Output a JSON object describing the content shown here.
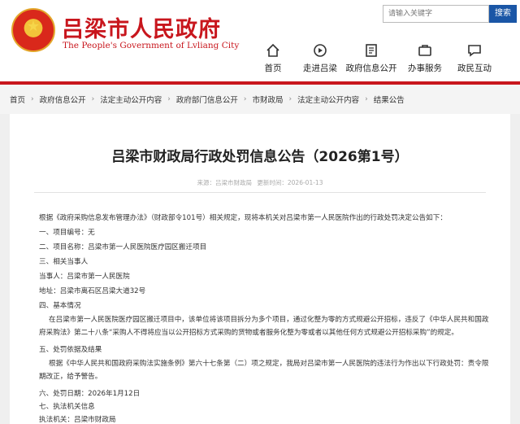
{
  "header": {
    "logo_cn": "吕梁市人民政府",
    "logo_en": "The People's Government of Lvliang City",
    "search_placeholder": "请输入关键字",
    "search_button": "搜索",
    "nav": [
      {
        "label": "首页",
        "icon": "home-icon"
      },
      {
        "label": "走进吕梁",
        "icon": "compass-icon"
      },
      {
        "label": "政府信息公开",
        "icon": "document-icon"
      },
      {
        "label": "办事服务",
        "icon": "service-icon"
      },
      {
        "label": "政民互动",
        "icon": "chat-icon"
      }
    ]
  },
  "breadcrumb": [
    "首页",
    "政府信息公开",
    "法定主动公开内容",
    "政府部门信息公开",
    "市财政局",
    "法定主动公开内容",
    "结果公告"
  ],
  "article": {
    "title": "吕梁市财政局行政处罚信息公告（2026第1号）",
    "source_label": "来源：吕梁市财政局",
    "date_label": "更新时间：2026-01-13",
    "lines": [
      "根据《政府采购信息发布管理办法》（财政部令101号）相关规定，现将本机关对吕梁市第一人民医院作出的行政处罚决定公告如下：",
      "一、项目编号：无",
      "二、项目名称：吕梁市第一人民医院医疗园区搬迁项目",
      "三、相关当事人",
      "当事人：吕梁市第一人民医院",
      "地址：吕梁市离石区吕梁大道32号",
      "四、基本情况",
      "在吕梁市第一人民医院医疗园区搬迁项目中，该单位将该项目拆分为多个项目，通过化整为零的方式规避公开招标，违反了《中华人民共和国政府采购法》第二十八条“采购人不得将应当以公开招标方式采购的货物或者服务化整为零或者以其他任何方式规避公开招标采购”的规定。",
      "五、处罚依据及结果",
      "根据《中华人民共和国政府采购法实施条例》第六十七条第（二）项之规定，我局对吕梁市第一人民医院的违法行为作出以下行政处罚：责令限期改正，给予警告。",
      "六、处罚日期：2026年1月12日",
      "七、执法机关信息",
      "执法机关：吕梁市财政局"
    ]
  },
  "colors": {
    "brand_red": "#c8161d",
    "search_blue": "#1a56a6"
  }
}
